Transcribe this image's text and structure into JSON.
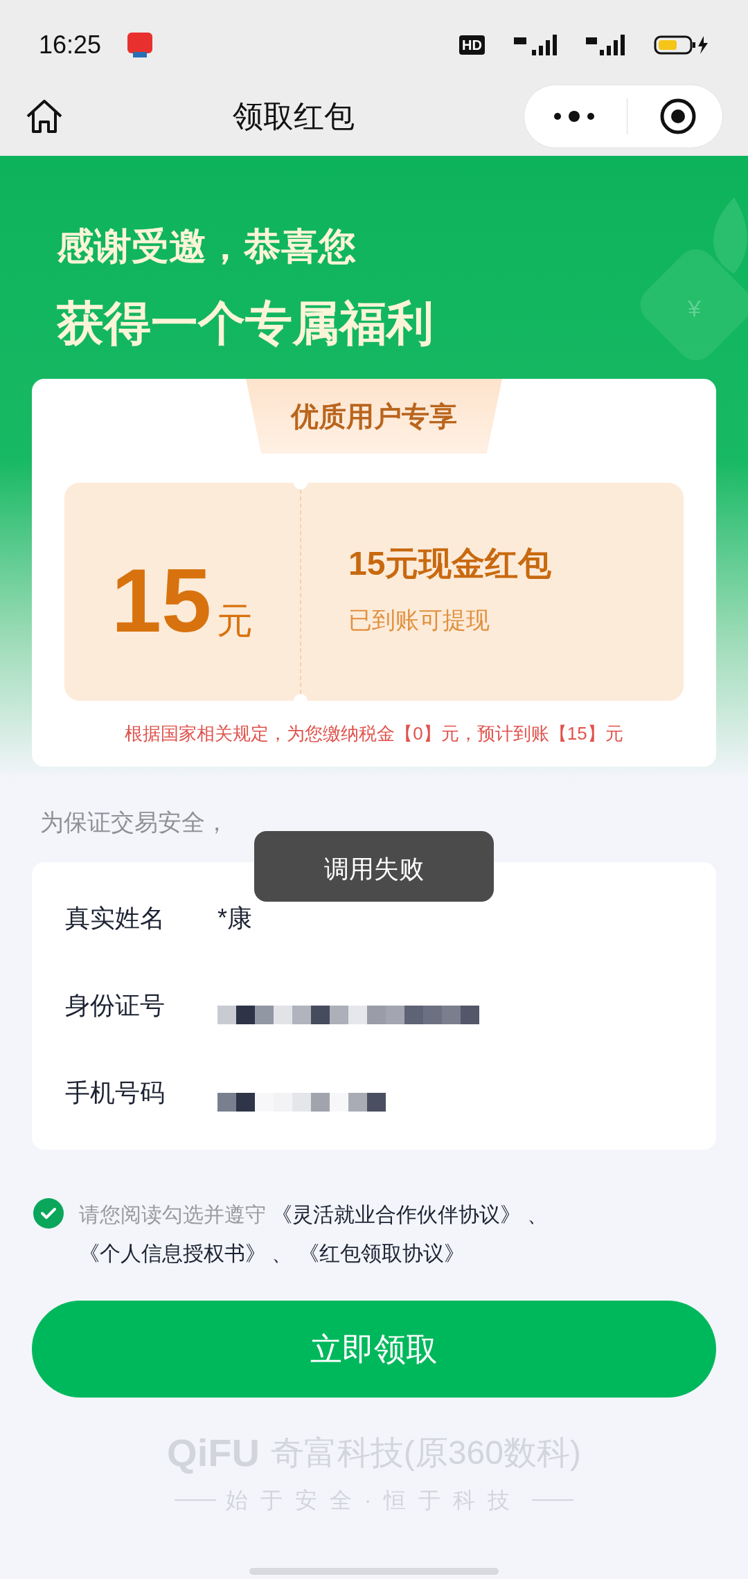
{
  "status_bar": {
    "time": "16:25",
    "network_badge": "HD"
  },
  "nav_bar": {
    "title": "领取红包"
  },
  "hero": {
    "line_1": "感谢受邀，恭喜您",
    "line_2": "获得一个专属福利",
    "coin_symbol": "¥"
  },
  "reward_card": {
    "tab": "优质用户专享",
    "amount": "15",
    "unit": "元",
    "title": "15元现金红包",
    "subtitle": "已到账可提现",
    "tax_note": "根据国家相关规定，为您缴纳税金【0】元，预计到账【15】元"
  },
  "notice": "为保证交易安全，",
  "toast": "调用失败",
  "info_rows": [
    {
      "label": "真实姓名",
      "kind": "text",
      "value": "*康"
    },
    {
      "label": "身份证号",
      "kind": "masked"
    },
    {
      "label": "手机号码",
      "kind": "masked_short"
    }
  ],
  "agreement": {
    "checked": true,
    "prefix": "请您阅读勾选并遵守",
    "links": [
      "《灵活就业合作伙伴协议》",
      "《个人信息授权书》",
      "《红包领取协议》"
    ],
    "separator": "、"
  },
  "claim_button": "立即领取",
  "footer": {
    "logo": "QiFU",
    "company": "奇富科技(原360数科)",
    "slogan": "始于安全·恒于科技"
  }
}
